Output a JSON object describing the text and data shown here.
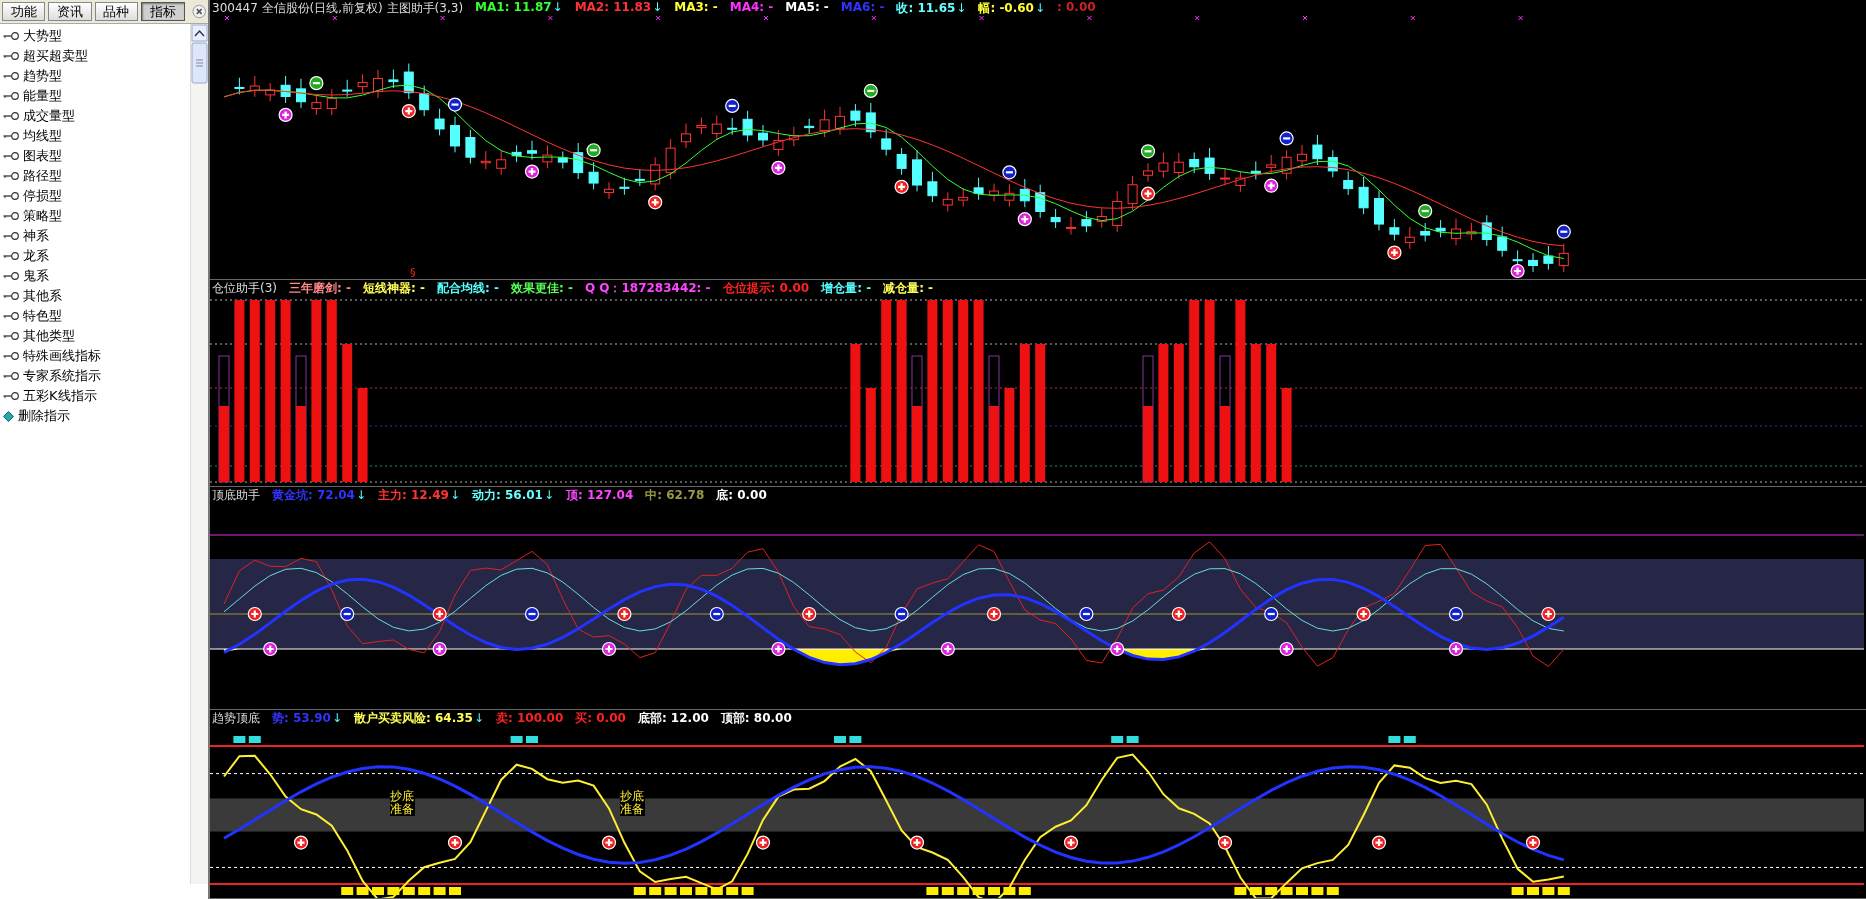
{
  "sidebar": {
    "tabs": [
      {
        "label": "功能",
        "selected": false
      },
      {
        "label": "资讯",
        "selected": false
      },
      {
        "label": "品种",
        "selected": false
      },
      {
        "label": "指标",
        "selected": true
      }
    ],
    "items": [
      {
        "label": "大势型",
        "kind": "category"
      },
      {
        "label": "超买超卖型",
        "kind": "category"
      },
      {
        "label": "趋势型",
        "kind": "category"
      },
      {
        "label": "能量型",
        "kind": "category"
      },
      {
        "label": "成交量型",
        "kind": "category"
      },
      {
        "label": "均线型",
        "kind": "category"
      },
      {
        "label": "图表型",
        "kind": "category"
      },
      {
        "label": "路径型",
        "kind": "category"
      },
      {
        "label": "停损型",
        "kind": "category"
      },
      {
        "label": "策略型",
        "kind": "category"
      },
      {
        "label": "神系",
        "kind": "category"
      },
      {
        "label": "龙系",
        "kind": "category"
      },
      {
        "label": "鬼系",
        "kind": "category"
      },
      {
        "label": "其他系",
        "kind": "category"
      },
      {
        "label": "特色型",
        "kind": "category"
      },
      {
        "label": "其他类型",
        "kind": "category"
      },
      {
        "label": "特殊画线指标",
        "kind": "category"
      },
      {
        "label": "专家系统指示",
        "kind": "category"
      },
      {
        "label": "五彩K线指示",
        "kind": "category"
      },
      {
        "label": "删除指示",
        "kind": "action"
      }
    ]
  },
  "panes": [
    {
      "kind": "candles",
      "title": "300447 全信股份(日线,前复权) 主图助手(3,3)",
      "marker_text": "§",
      "legend": [
        {
          "text": "MA1: 11.87",
          "arrow": "↓",
          "color": "#33ff33"
        },
        {
          "text": "MA2: 11.83",
          "arrow": "↓",
          "color": "#ff3333"
        },
        {
          "text": "MA3: -",
          "color": "#ffff33"
        },
        {
          "text": "MA4: -",
          "color": "#ff33ff"
        },
        {
          "text": "MA5: -",
          "color": "#ffffff"
        },
        {
          "text": "MA6: -",
          "color": "#3333ff"
        },
        {
          "text": "收: 11.65",
          "arrow": "↓",
          "color": "#66ffff"
        },
        {
          "text": "幅: -0.60",
          "arrow": "↓",
          "color": "#ffff33"
        },
        {
          "text": ": 0.00",
          "color": "#cc2222"
        }
      ]
    },
    {
      "kind": "bars",
      "title": "仓位助手(3)",
      "legend": [
        {
          "text": "三年磨剑: -",
          "color": "#ff8888"
        },
        {
          "text": "短线神器: -",
          "color": "#ffff55"
        },
        {
          "text": "配合均线: -",
          "color": "#55ffff"
        },
        {
          "text": "效果更佳: -",
          "color": "#55ff55"
        },
        {
          "text": "Q Q：187283442: -",
          "color": "#ff44ff"
        },
        {
          "text": "仓位提示: 0.00",
          "color": "#ff2222"
        },
        {
          "text": "增仓量: -",
          "color": "#55ffff"
        },
        {
          "text": "减仓量: -",
          "color": "#ffff55"
        }
      ]
    },
    {
      "kind": "oscillator",
      "title": "顶底助手",
      "legend": [
        {
          "text": "黄金坑: 72.04",
          "arrow": "↓",
          "color": "#3333ff"
        },
        {
          "text": "主力: 12.49",
          "arrow": "↓",
          "color": "#ff3333"
        },
        {
          "text": "动力: 56.01",
          "arrow": "↓",
          "color": "#66ffff"
        },
        {
          "text": "顶: 127.04",
          "color": "#ff44ff"
        },
        {
          "text": "中: 62.78",
          "color": "#999944"
        },
        {
          "text": "底: 0.00",
          "color": "#ffffff"
        }
      ]
    },
    {
      "kind": "trend",
      "title": "趋势顶底",
      "callouts": [
        "抄底准备",
        "抄底准备"
      ],
      "legend": [
        {
          "text": "势: 53.90",
          "arrow": "↓",
          "color": "#3333ff"
        },
        {
          "text": "散户买卖风险: 64.35",
          "arrow": "↓",
          "color": "#ffff55"
        },
        {
          "text": "卖: 100.00",
          "color": "#ff2222"
        },
        {
          "text": "买: 0.00",
          "color": "#ff2222"
        },
        {
          "text": "底部: 12.00",
          "color": "#ffffff"
        },
        {
          "text": "顶部: 80.00",
          "color": "#ffffff"
        }
      ]
    }
  ]
}
